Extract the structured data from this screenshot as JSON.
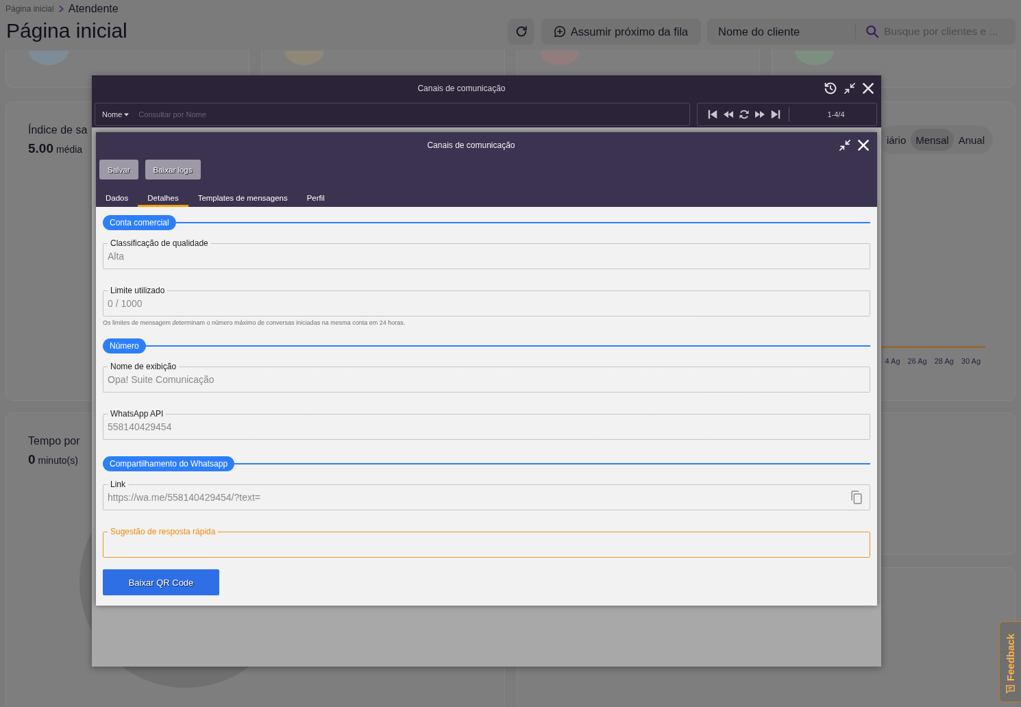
{
  "breadcrumb": [
    {
      "label": "Página inicial",
      "current": false
    },
    {
      "label": "Atendente",
      "current": true
    }
  ],
  "page_title": "Página inicial",
  "header_actions": {
    "queue_button": "Assumir próximo da fila",
    "client_filter": "Nome do cliente",
    "search": {
      "placeholder": "Busque por clientes e ..."
    }
  },
  "summary_cards": [
    {
      "color": "#7e8c97"
    },
    {
      "color": "#8f8778"
    },
    {
      "color": "#927c7c"
    },
    {
      "color": "#7d8f7f"
    }
  ],
  "satisfaction_card": {
    "title": "Índice de sa",
    "value": "5.00",
    "caption": "média"
  },
  "period_card": {
    "periods": [
      {
        "label": "iário",
        "selected": false
      },
      {
        "label": "Mensal",
        "selected": true
      },
      {
        "label": "Anual",
        "selected": false
      }
    ],
    "x_labels": [
      "4 Ag",
      "26 Ag",
      "28 Ag",
      "30 Ag"
    ]
  },
  "time_card": {
    "title": "Tempo por",
    "value": "0",
    "caption": "minuto(s)"
  },
  "feedback_tab": {
    "label": "Feedback"
  },
  "channels_window": {
    "title": "Canais de comunicação",
    "search": {
      "field": "Nome",
      "placeholder": "Consultar por Nome"
    },
    "pagination": "1-4/4"
  },
  "detail_window": {
    "title": "Canais de comunicação",
    "buttons": [
      "Salvar",
      "Baixar logs"
    ],
    "tabs": [
      {
        "label": "Dados",
        "selected": false
      },
      {
        "label": "Detalhes",
        "selected": true
      },
      {
        "label": "Templates de mensagens",
        "selected": false
      },
      {
        "label": "Perfil",
        "selected": false
      }
    ],
    "sections": [
      {
        "title": "Conta comercial",
        "fields": [
          {
            "kind": "text",
            "label": "Classificação de qualidade",
            "value": "Alta",
            "focused": false
          },
          {
            "kind": "text",
            "label": "Limite utilizado",
            "value": "0 / 1000",
            "focused": false,
            "help": "Os limites de mensagem determinam o número máximo de conversas iniciadas na mesma conta em 24 horas."
          }
        ]
      },
      {
        "title": "Número",
        "fields": [
          {
            "kind": "text",
            "label": "Nome de exibição",
            "value": "Opa! Suite Comunicação",
            "focused": false
          },
          {
            "kind": "text",
            "label": "WhatsApp API",
            "value": "558140429454",
            "focused": false
          }
        ]
      },
      {
        "title": "Compartilhamento do Whatsapp",
        "fields": [
          {
            "kind": "copy",
            "label": "Link",
            "value": "https://wa.me/558140429454/?text=",
            "focused": false
          },
          {
            "kind": "input",
            "label": "Sugestão de resposta rápida",
            "focused": true
          }
        ]
      }
    ],
    "qr_button": "Baixar QR Code"
  }
}
